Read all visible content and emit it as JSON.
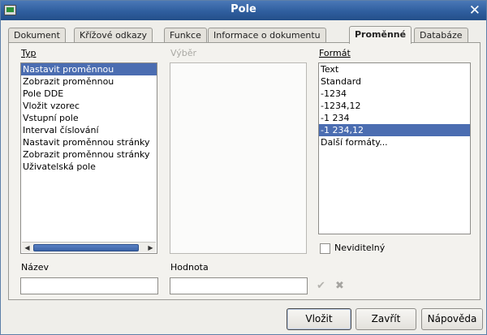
{
  "window": {
    "title": "Pole"
  },
  "tabs": [
    {
      "label": "Dokument",
      "active": false
    },
    {
      "label": "Křížové odkazy",
      "active": false
    },
    {
      "label": "Funkce",
      "active": false
    },
    {
      "label": "Informace o dokumentu",
      "active": false
    },
    {
      "label": "Proměnné",
      "active": true
    },
    {
      "label": "Databáze",
      "active": false
    }
  ],
  "type_section": {
    "label": "Typ",
    "items": [
      "Nastavit proměnnou",
      "Zobrazit proměnnou",
      "Pole DDE",
      "Vložit vzorec",
      "Vstupní pole",
      "Interval číslování",
      "Nastavit proměnnou stránky",
      "Zobrazit proměnnou stránky",
      "Uživatelská pole"
    ],
    "selected": "Nastavit proměnnou"
  },
  "selection_section": {
    "label": "Výběr",
    "items": []
  },
  "format_section": {
    "label": "Formát",
    "items": [
      "Text",
      "Standard",
      "-1234",
      "-1234,12",
      "-1 234",
      "-1 234,12",
      "Další formáty..."
    ],
    "selected": "-1 234,12"
  },
  "invisible_checkbox": {
    "label": "Neviditelný",
    "checked": false
  },
  "name_field": {
    "label": "Název",
    "value": ""
  },
  "value_field": {
    "label": "Hodnota",
    "value": ""
  },
  "buttons": {
    "insert": "Vložit",
    "close": "Zavřít",
    "help": "Nápověda"
  },
  "colors": {
    "selection": "#4b6db1",
    "titlebar": "#2f5e9e"
  }
}
